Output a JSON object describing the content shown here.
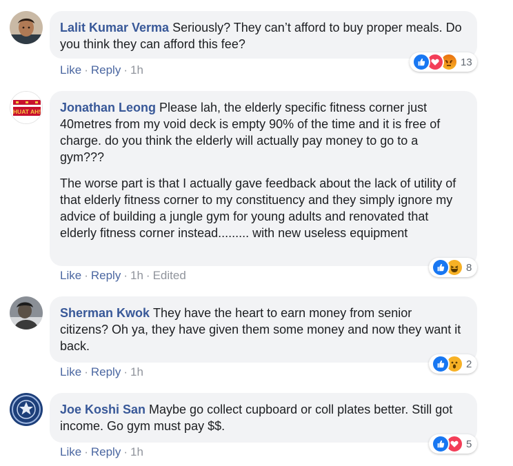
{
  "comments": [
    {
      "author": "Lalit Kumar Verma",
      "paragraphs": [
        "Seriously? They can’t afford to buy proper meals. Do you think they can afford this fee?"
      ],
      "actions": {
        "like": "Like",
        "reply": "Reply",
        "time": "1h"
      },
      "reactions": {
        "icons": [
          "like-icon",
          "love-icon",
          "angry-icon"
        ],
        "count": "13"
      }
    },
    {
      "author": "Jonathan Leong",
      "avatar_text": "HUAT AH!",
      "paragraphs": [
        "Please lah, the elderly specific fitness corner just 40metres from my void deck is empty 90% of the time and it is free of charge. do you think the elderly will actually pay money to go to a gym???",
        "The worse part is that I actually gave feedback about the lack of utility of that elderly fitness corner to my constituency and they simply ignore my advice of building a jungle gym for young adults and renovated that elderly fitness corner instead......... with new useless equipment"
      ],
      "actions": {
        "like": "Like",
        "reply": "Reply",
        "time": "1h",
        "edited": "Edited"
      },
      "reactions": {
        "icons": [
          "like-icon",
          "haha-icon"
        ],
        "count": "8"
      }
    },
    {
      "author": "Sherman Kwok",
      "paragraphs": [
        "They have the heart to earn money from senior citizens? Oh ya, they have given them some money and now they want it back."
      ],
      "actions": {
        "like": "Like",
        "reply": "Reply",
        "time": "1h"
      },
      "reactions": {
        "icons": [
          "like-icon",
          "wow-icon"
        ],
        "count": "2"
      }
    },
    {
      "author": "Joe Koshi San",
      "paragraphs": [
        "Maybe go collect cupboard or coll plates better. Still got income. Go gym must pay $$."
      ],
      "actions": {
        "like": "Like",
        "reply": "Reply",
        "time": "1h"
      },
      "reactions": {
        "icons": [
          "like-icon",
          "love-icon"
        ],
        "count": "5"
      }
    }
  ],
  "colors": {
    "author": "#385898",
    "action": "#4b67a1",
    "meta": "#90949c",
    "bubble": "#f2f3f5",
    "like": "#1877f2",
    "love": "#f33e58"
  }
}
